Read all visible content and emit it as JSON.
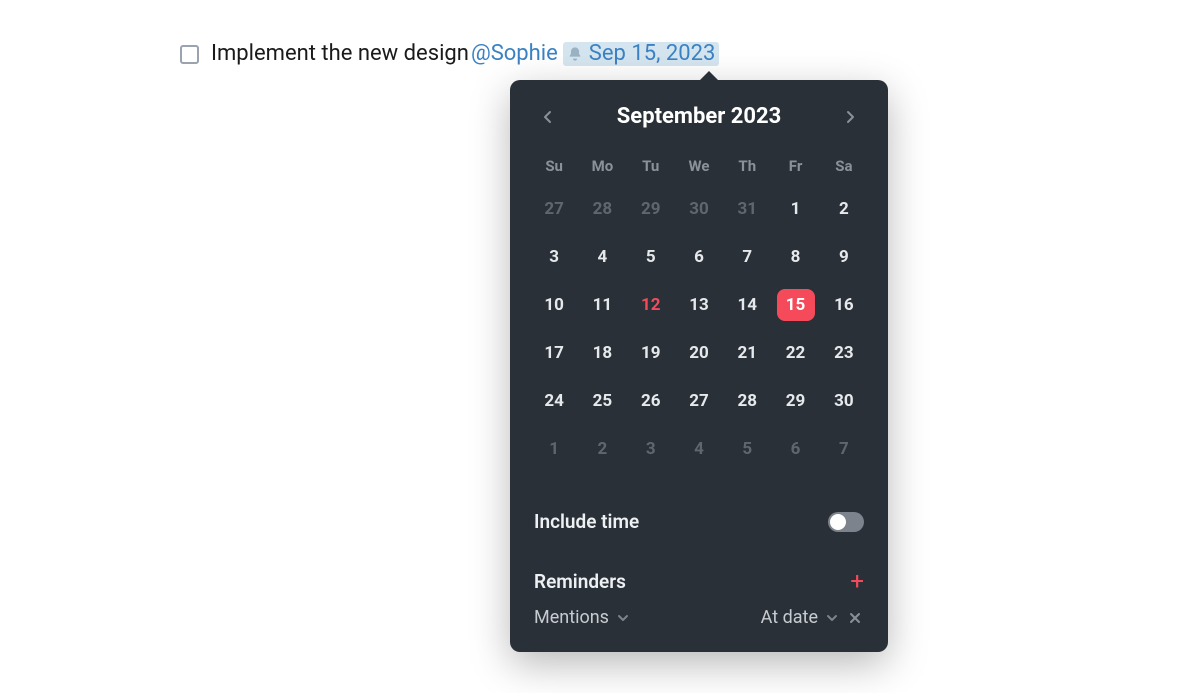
{
  "todo": {
    "text": "Implement the new design ",
    "mention": "@Sophie",
    "date_label": "Sep 15, 2023"
  },
  "calendar": {
    "title": "September 2023",
    "dow": [
      "Su",
      "Mo",
      "Tu",
      "We",
      "Th",
      "Fr",
      "Sa"
    ],
    "weeks": [
      [
        {
          "n": "27",
          "dim": true
        },
        {
          "n": "28",
          "dim": true
        },
        {
          "n": "29",
          "dim": true
        },
        {
          "n": "30",
          "dim": true
        },
        {
          "n": "31",
          "dim": true
        },
        {
          "n": "1"
        },
        {
          "n": "2"
        }
      ],
      [
        {
          "n": "3"
        },
        {
          "n": "4"
        },
        {
          "n": "5"
        },
        {
          "n": "6"
        },
        {
          "n": "7"
        },
        {
          "n": "8"
        },
        {
          "n": "9"
        }
      ],
      [
        {
          "n": "10"
        },
        {
          "n": "11"
        },
        {
          "n": "12",
          "today": true
        },
        {
          "n": "13"
        },
        {
          "n": "14"
        },
        {
          "n": "15",
          "selected": true
        },
        {
          "n": "16"
        }
      ],
      [
        {
          "n": "17"
        },
        {
          "n": "18"
        },
        {
          "n": "19"
        },
        {
          "n": "20"
        },
        {
          "n": "21"
        },
        {
          "n": "22"
        },
        {
          "n": "23"
        }
      ],
      [
        {
          "n": "24"
        },
        {
          "n": "25"
        },
        {
          "n": "26"
        },
        {
          "n": "27"
        },
        {
          "n": "28"
        },
        {
          "n": "29"
        },
        {
          "n": "30"
        }
      ],
      [
        {
          "n": "1",
          "dim": true
        },
        {
          "n": "2",
          "dim": true
        },
        {
          "n": "3",
          "dim": true
        },
        {
          "n": "4",
          "dim": true
        },
        {
          "n": "5",
          "dim": true
        },
        {
          "n": "6",
          "dim": true
        },
        {
          "n": "7",
          "dim": true
        }
      ]
    ]
  },
  "include_time": {
    "label": "Include time",
    "on": false
  },
  "reminders": {
    "label": "Reminders",
    "row": {
      "type": "Mentions",
      "when": "At date"
    }
  }
}
